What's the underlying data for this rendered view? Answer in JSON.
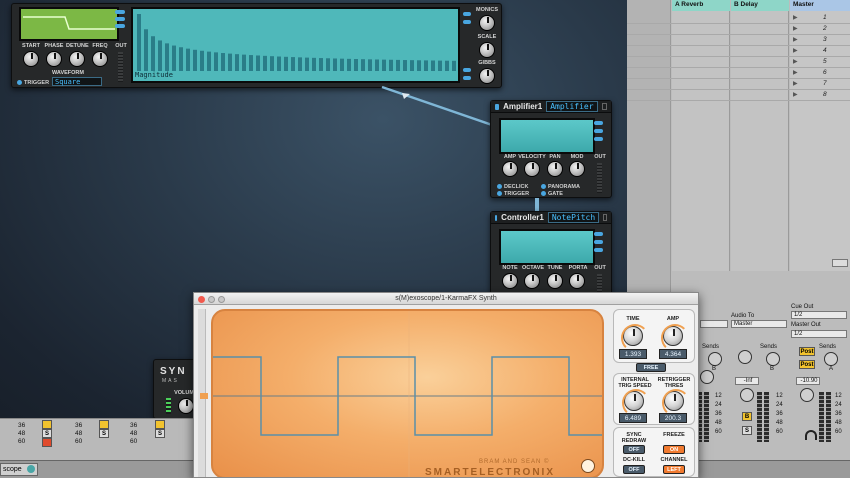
{
  "synth_module": {
    "knobs": [
      "START",
      "PHASE",
      "DETUNE",
      "FREQ"
    ],
    "out_label": "OUT",
    "waveform_label": "WAVEFORM",
    "waveform_value": "Square",
    "trigger_label": "TRIGGER",
    "harmonics_lcd": "Magnitude",
    "right_knobs": [
      "MONICS",
      "SCALE",
      "GIBBS"
    ]
  },
  "amplifier": {
    "title": "Amplifier1",
    "subtitle": "Amplifier",
    "knobs": [
      "AMP",
      "VELOCITY",
      "PAN",
      "MOD"
    ],
    "out_label": "OUT",
    "toggles": [
      "DECLICK",
      "TRIGGER",
      "PANORAMA",
      "GATE"
    ]
  },
  "controller": {
    "title": "Controller1",
    "subtitle": "NotePitch",
    "knobs": [
      "NOTE",
      "OCTAVE",
      "TUNE",
      "PORTA"
    ],
    "out_label": "OUT"
  },
  "synth_partial": {
    "name": "SYN",
    "sub": "MAS",
    "volume_label": "VOLUM"
  },
  "bottom_left": {
    "tab_label": "scope",
    "rows": [
      "36",
      "48",
      "60"
    ],
    "record_button": "S"
  },
  "live": {
    "columns": [
      "A Reverb",
      "B Delay",
      "Master"
    ],
    "scenes": [
      "1",
      "2",
      "3",
      "4",
      "5",
      "6",
      "7",
      "8"
    ],
    "audio_to_label": "Audio To",
    "audio_to_value": "Master",
    "cue_out_label": "Cue Out",
    "cue_out_value": "1/2",
    "master_out_label": "Master Out",
    "master_out_value": "1/2",
    "sends_label": "Sends",
    "post_label": "Post",
    "send_letters": [
      "A",
      "B"
    ],
    "volume_readouts": [
      "-Inf",
      "-10.90"
    ],
    "solo_a": "S",
    "b_button": "B",
    "level_marks": [
      "12",
      "24",
      "36",
      "48",
      "60"
    ]
  },
  "exoscope": {
    "title": "s(M)exoscope/1-KarmaFX Synth",
    "time_label": "TIME",
    "time_value": "1.393",
    "amp_label": "AMP",
    "amp_value": "4.364",
    "free_label": "FREE",
    "internal_trig_label": "INTERNAL\nTRIG SPEED",
    "internal_trig_value": "6.489",
    "retrigger_label": "RETRIGGER\nTHRES",
    "retrigger_value": "200.3",
    "sync_redraw_label": "SYNC\nREDRAW",
    "sync_value": "OFF",
    "freeze_label": "FREEZE",
    "freeze_value": "ON",
    "dckill_label": "DC-KILL",
    "dckill_value": "OFF",
    "channel_label": "CHANNEL",
    "channel_value": "LEFT",
    "credit_top": "BRAM AND SEAN ©",
    "credit_brand": "SMARTELECTRONIX"
  },
  "colors": {
    "lcd": "#4fb8ba",
    "accent": "#49a6e0",
    "scope_orange": "#f4ae6a",
    "trace": "#5a8fa8",
    "live_highlight": "#8ed6c8"
  }
}
